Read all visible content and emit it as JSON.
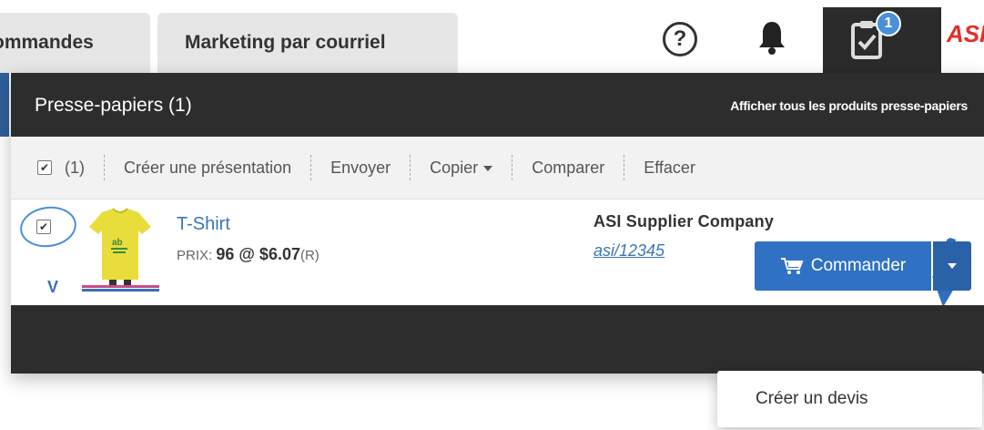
{
  "nav": {
    "tabs": [
      {
        "label": "ommandes"
      },
      {
        "label": "Marketing par courriel"
      }
    ],
    "help_icon": "question-circle-icon",
    "bell_icon": "bell-icon",
    "clipboard_icon": "clipboard-check-icon",
    "clipboard_badge": "1",
    "logo_text": "ASI",
    "accent_color": "#4a90d9"
  },
  "panel": {
    "title": "Presse-papiers (1)",
    "view_all_link": "Afficher tous les produits presse-papiers",
    "toolbar": {
      "count": "(1)",
      "create_presentation": "Créer une présentation",
      "send": "Envoyer",
      "copy": "Copier",
      "compare": "Comparer",
      "clear": "Effacer"
    },
    "item": {
      "name": "T-Shirt",
      "price_label": "PRIX:",
      "price_value": "96 @ $6.07",
      "price_code": "(R)",
      "supplier_name": "ASI Supplier Company",
      "supplier_id": "asi/12345",
      "checked": true
    },
    "order_button": "Commander",
    "order_menu": {
      "items": [
        "Créer un devis"
      ]
    }
  },
  "colors": {
    "dark_bar": "#2d2d2d",
    "primary_button": "#2f72c4",
    "link": "#3a78b5"
  }
}
